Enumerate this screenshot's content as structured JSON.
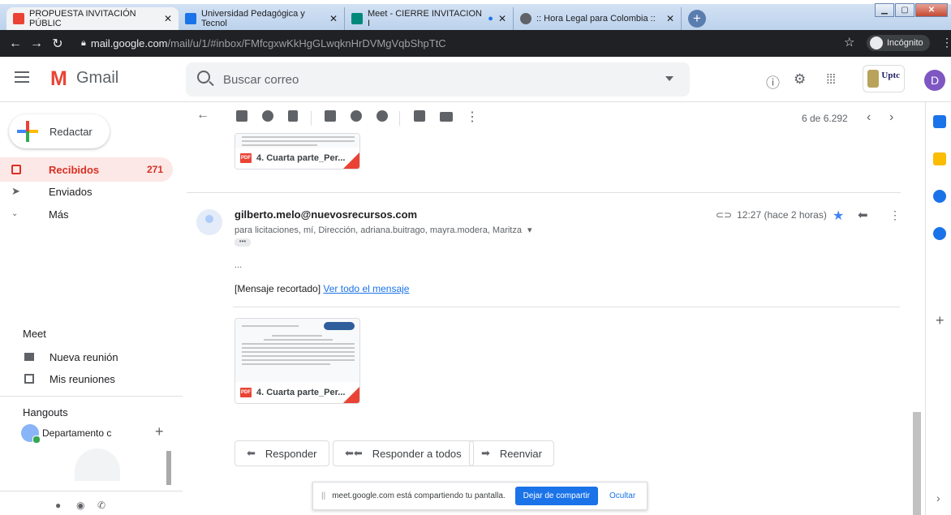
{
  "browser": {
    "tabs": [
      {
        "title": "PROPUESTA INVITACIÓN PÚBLIC",
        "icon": "gmail-icon"
      },
      {
        "title": "Universidad Pedagógica y Tecnol",
        "icon": "calendar-icon"
      },
      {
        "title": "Meet - CIERRE INVITACION I",
        "icon": "meet-icon"
      },
      {
        "title": ":: Hora Legal para Colombia ::",
        "icon": "globe-icon"
      }
    ],
    "url_host": "mail.google.com",
    "url_path": "/mail/u/1/#inbox/FMfcgxwKkHgGLwqknHrDVMgVqbShpTtC",
    "incognito_label": "Incógnito"
  },
  "gmail": {
    "logo_text": "Gmail",
    "search_placeholder": "Buscar correo",
    "account_initial": "D",
    "org_logo_text": "Uptc"
  },
  "sidebar": {
    "compose_label": "Redactar",
    "items": [
      {
        "label": "Recibidos",
        "count": "271"
      },
      {
        "label": "Enviados",
        "count": ""
      },
      {
        "label": "Más",
        "count": ""
      }
    ],
    "meet_title": "Meet",
    "meet_items": [
      {
        "label": "Nueva reunión"
      },
      {
        "label": "Mis reuniones"
      }
    ],
    "hangouts_title": "Hangouts",
    "hangouts_user": "Departamento c"
  },
  "toolbar": {
    "pager_text": "6 de 6.292"
  },
  "message": {
    "attachment_name": "4. Cuarta parte_Per...",
    "sender": "gilberto.melo@nuevosrecursos.com",
    "recipients": "para licitaciones, mí, Dirección, adriana.buitrago, mayra.modera, Maritza",
    "time": "12:27 (hace 2 horas)",
    "ellipsis": "...",
    "clipped_text": "[Mensaje recortado]",
    "view_all_link": "Ver todo el mensaje",
    "attachment2_name": "4. Cuarta parte_Per..."
  },
  "actions": {
    "reply": "Responder",
    "reply_all": "Responder a todos",
    "forward": "Reenviar"
  },
  "share_banner": {
    "text": "meet.google.com está compartiendo tu pantalla.",
    "stop_label": "Dejar de compartir",
    "hide_label": "Ocultar"
  },
  "colors": {
    "accent_blue": "#1a73e8",
    "inbox_red": "#d93025",
    "star_blue": "#4285f4"
  }
}
